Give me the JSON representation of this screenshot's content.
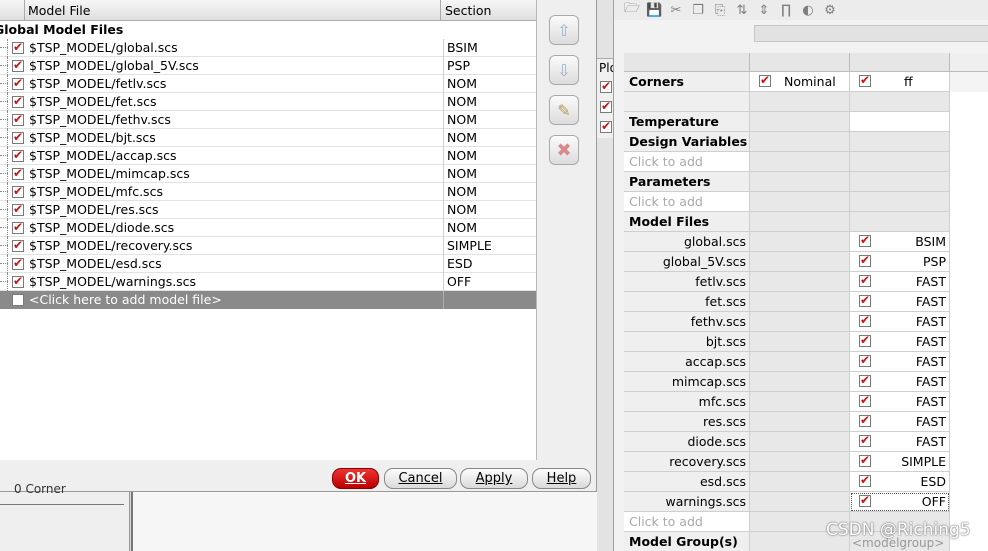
{
  "model_files_dialog": {
    "columns": {
      "model_file": "Model File",
      "section": "Section"
    },
    "group_label": "Global Model Files",
    "rows": [
      {
        "file": "$TSP_MODEL/global.scs",
        "section": "BSIM"
      },
      {
        "file": "$TSP_MODEL/global_5V.scs",
        "section": "PSP"
      },
      {
        "file": "$TSP_MODEL/fetlv.scs",
        "section": "NOM"
      },
      {
        "file": "$TSP_MODEL/fet.scs",
        "section": "NOM"
      },
      {
        "file": "$TSP_MODEL/fethv.scs",
        "section": "NOM"
      },
      {
        "file": "$TSP_MODEL/bjt.scs",
        "section": "NOM"
      },
      {
        "file": "$TSP_MODEL/accap.scs",
        "section": "NOM"
      },
      {
        "file": "$TSP_MODEL/mimcap.scs",
        "section": "NOM"
      },
      {
        "file": "$TSP_MODEL/mfc.scs",
        "section": "NOM"
      },
      {
        "file": "$TSP_MODEL/res.scs",
        "section": "NOM"
      },
      {
        "file": "$TSP_MODEL/diode.scs",
        "section": "NOM"
      },
      {
        "file": "$TSP_MODEL/recovery.scs",
        "section": "SIMPLE"
      },
      {
        "file": "$TSP_MODEL/esd.scs",
        "section": "ESD"
      },
      {
        "file": "$TSP_MODEL/warnings.scs",
        "section": "OFF"
      }
    ],
    "add_row_label": "<Click here to add model file>",
    "buttons": {
      "ok": "OK",
      "cancel": "Cancel",
      "apply": "Apply",
      "help": "Help"
    }
  },
  "bottom_left_text": "0 Corner",
  "middle_tab_label": "Plo",
  "corners_panel": {
    "corners_label": "Corners",
    "col1": "Nominal",
    "col2": "ff",
    "temperature_label": "Temperature",
    "design_variables_label": "Design Variables",
    "parameters_label": "Parameters",
    "click_to_add": "Click to add",
    "model_files_label": "Model Files",
    "model_rows": [
      {
        "name": "global.scs",
        "value": "BSIM"
      },
      {
        "name": "global_5V.scs",
        "value": "PSP"
      },
      {
        "name": "fetlv.scs",
        "value": "FAST"
      },
      {
        "name": "fet.scs",
        "value": "FAST"
      },
      {
        "name": "fethv.scs",
        "value": "FAST"
      },
      {
        "name": "bjt.scs",
        "value": "FAST"
      },
      {
        "name": "accap.scs",
        "value": "FAST"
      },
      {
        "name": "mimcap.scs",
        "value": "FAST"
      },
      {
        "name": "mfc.scs",
        "value": "FAST"
      },
      {
        "name": "res.scs",
        "value": "FAST"
      },
      {
        "name": "diode.scs",
        "value": "FAST"
      },
      {
        "name": "recovery.scs",
        "value": "SIMPLE"
      },
      {
        "name": "esd.scs",
        "value": "ESD"
      },
      {
        "name": "warnings.scs",
        "value": "OFF"
      }
    ],
    "model_group_label": "Model Group(s)",
    "model_group_placeholder": "<modelgroup>"
  },
  "watermark": "CSDN @Riching5"
}
